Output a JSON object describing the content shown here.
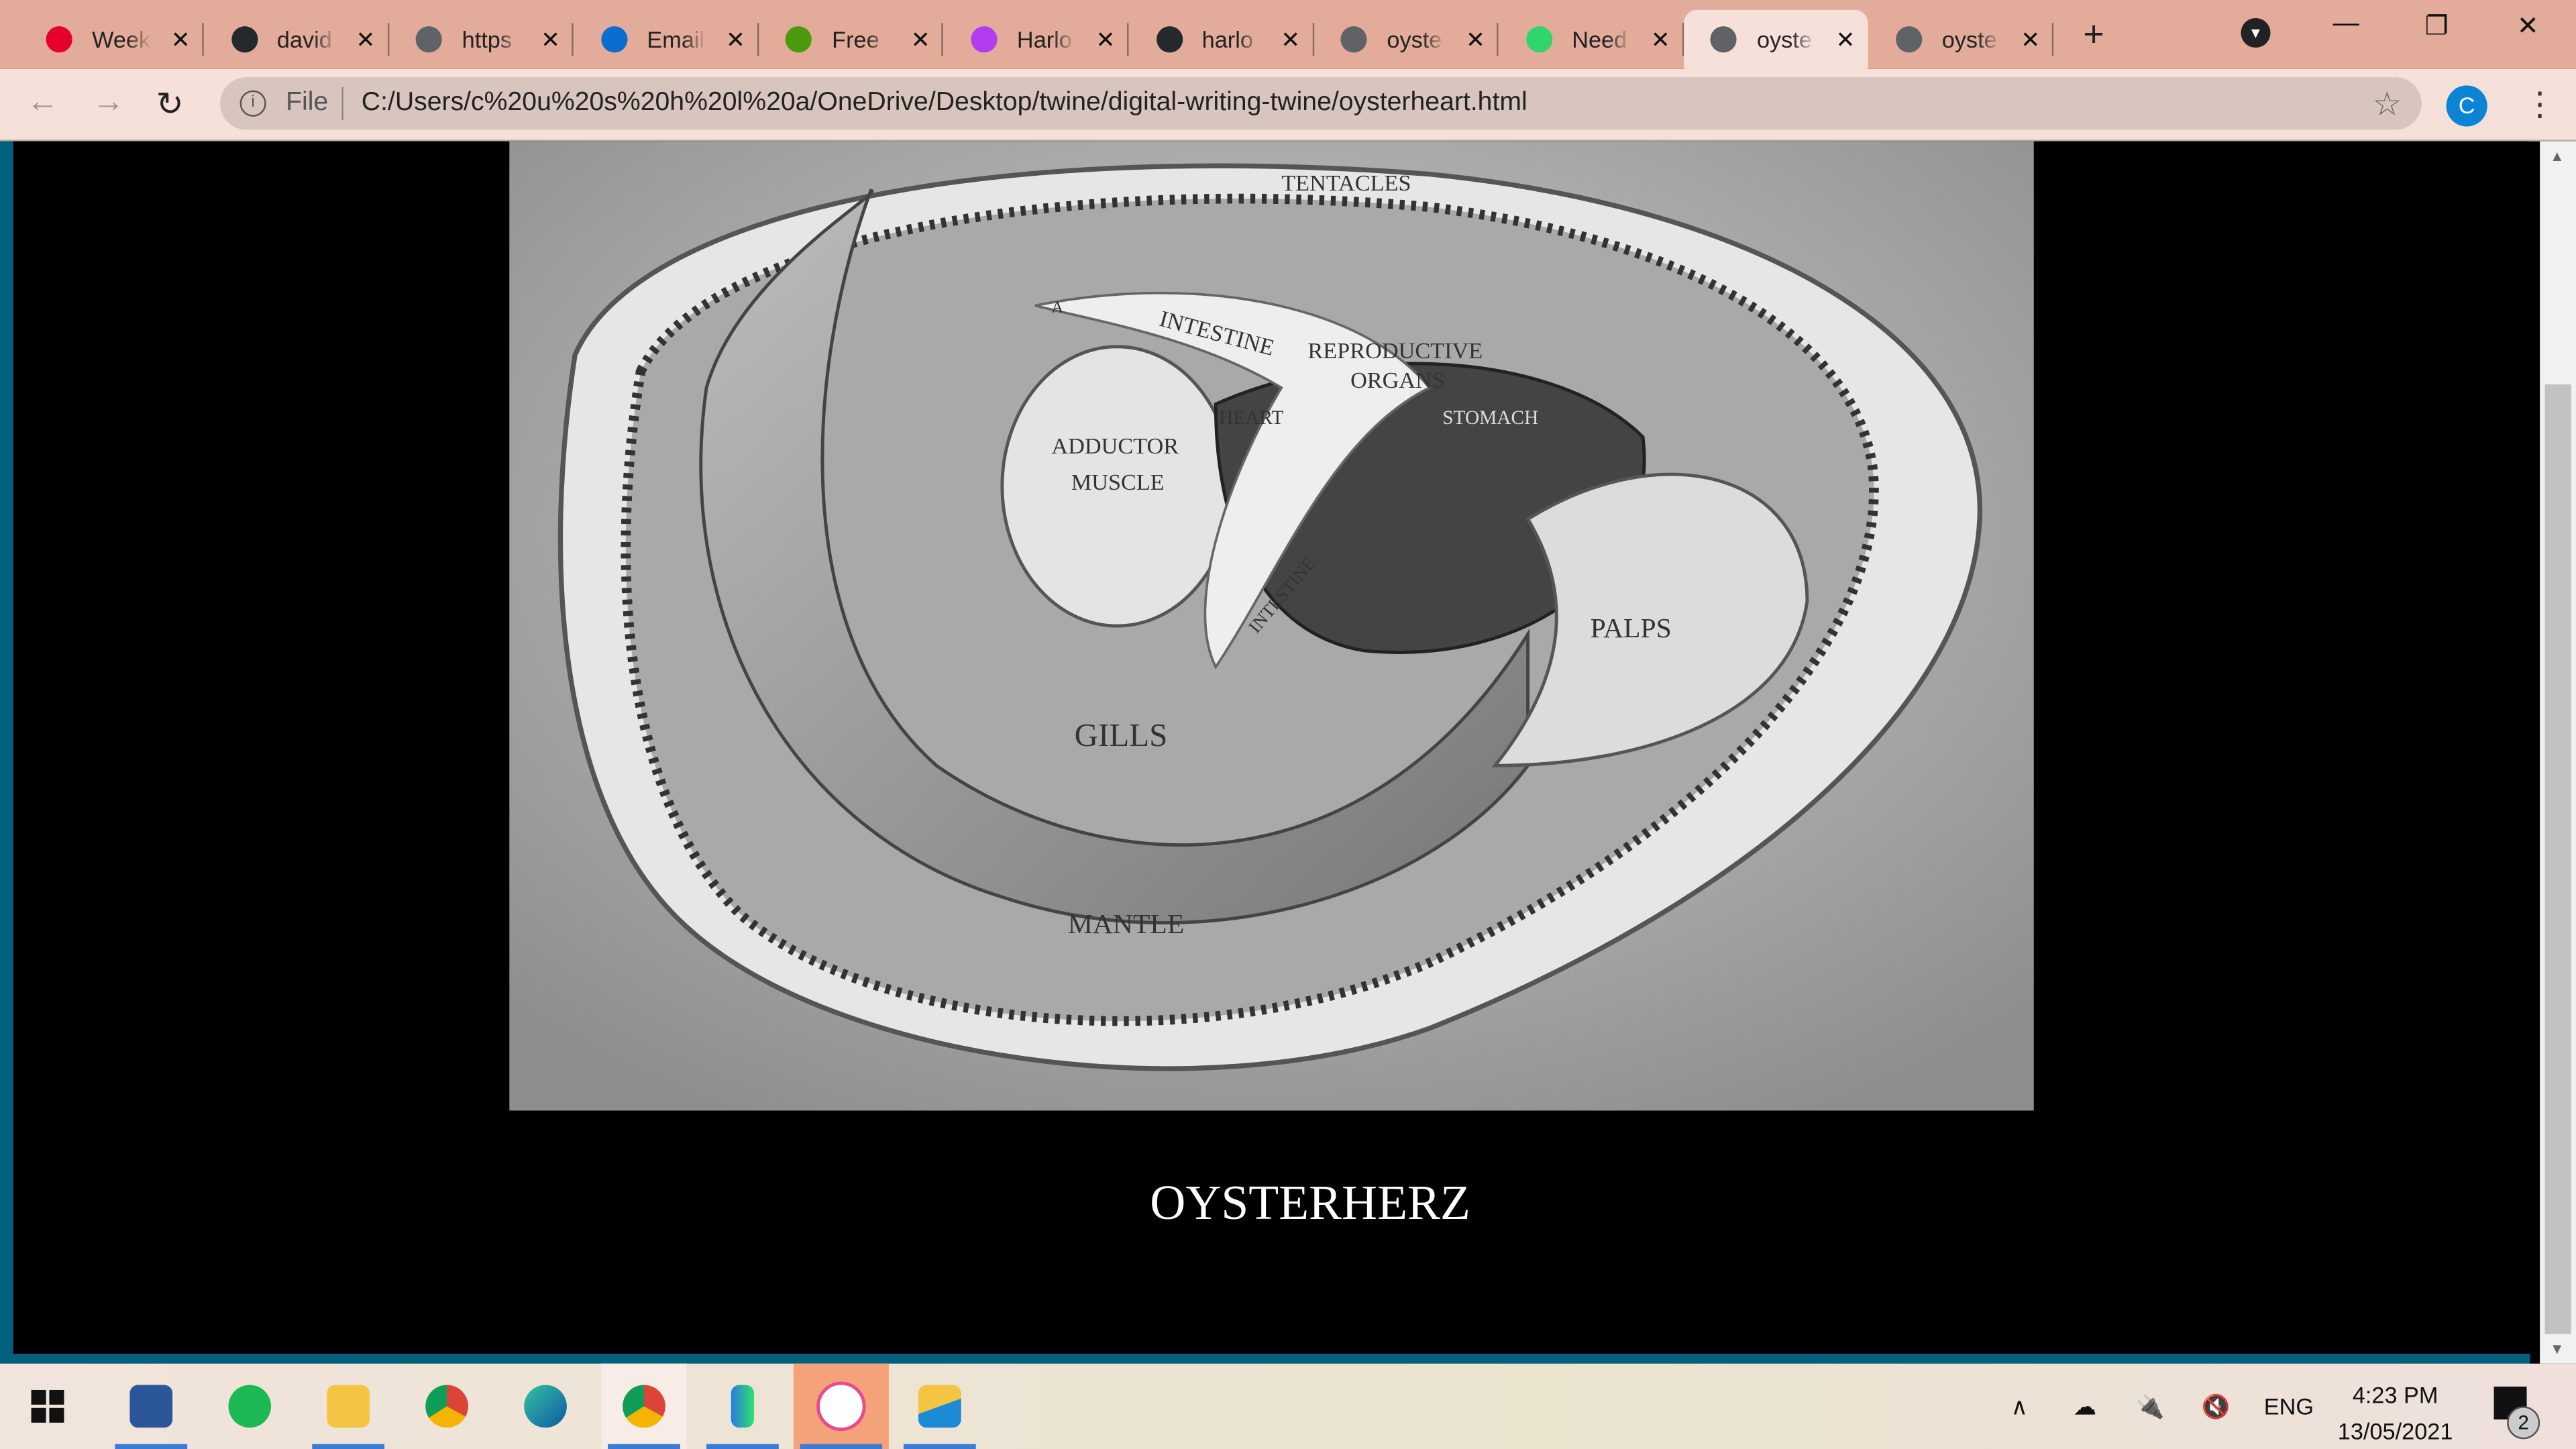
{
  "browser": {
    "tabs": [
      {
        "title": "Week",
        "icon": "red-app-icon",
        "color": "#e6002d"
      },
      {
        "title": "david",
        "icon": "github-icon",
        "color": "#24292e"
      },
      {
        "title": "https",
        "icon": "globe-icon",
        "color": "#5f6368"
      },
      {
        "title": "Email",
        "icon": "outlook-icon",
        "color": "#0a6ed1"
      },
      {
        "title": "Free",
        "icon": "image-icon",
        "color": "#4a9a0c"
      },
      {
        "title": "Harlo",
        "icon": "harlo-icon",
        "color": "#b13cf0"
      },
      {
        "title": "harlo",
        "icon": "github-icon",
        "color": "#24292e"
      },
      {
        "title": "oyste",
        "icon": "globe-icon",
        "color": "#5f6368"
      },
      {
        "title": "Need",
        "icon": "flag-icon",
        "color": "#2fd66b"
      },
      {
        "title": "oyste",
        "icon": "globe-icon",
        "color": "#5f6368",
        "active": true
      },
      {
        "title": "oyste",
        "icon": "globe-icon",
        "color": "#5f6368"
      }
    ],
    "close_glyph": "✕",
    "new_tab": "+",
    "address": {
      "scheme_label": "File",
      "url": "C:/Users/c%20u%20s%20h%20l%20a/OneDrive/Desktop/twine/digital-writing-twine/oysterheart.html"
    },
    "profile_initial": "C"
  },
  "page": {
    "illustration_labels": {
      "tentacles": "TENTACLES",
      "intestine_top": "INTESTINE",
      "reproductive": "REPRODUCTIVE",
      "organs": "ORGANS",
      "heart": "HEART",
      "stomach": "STOMACH",
      "adductor": "ADDUCTOR",
      "muscle": "MUSCLE",
      "intestine_low": "INTESTINE",
      "palps": "PALPS",
      "gills": "GILLS",
      "mantle": "MANTLE",
      "a": "A"
    },
    "caption": "OYSTERHERZ"
  },
  "taskbar": {
    "apps": [
      "word",
      "spotify",
      "file-explorer",
      "chrome",
      "edge",
      "chrome-profile",
      "flag-app",
      "itunes",
      "onedrive-app"
    ],
    "tray": {
      "language": "ENG",
      "time": "4:23 PM",
      "date": "13/05/2021",
      "notifications": "2"
    }
  }
}
